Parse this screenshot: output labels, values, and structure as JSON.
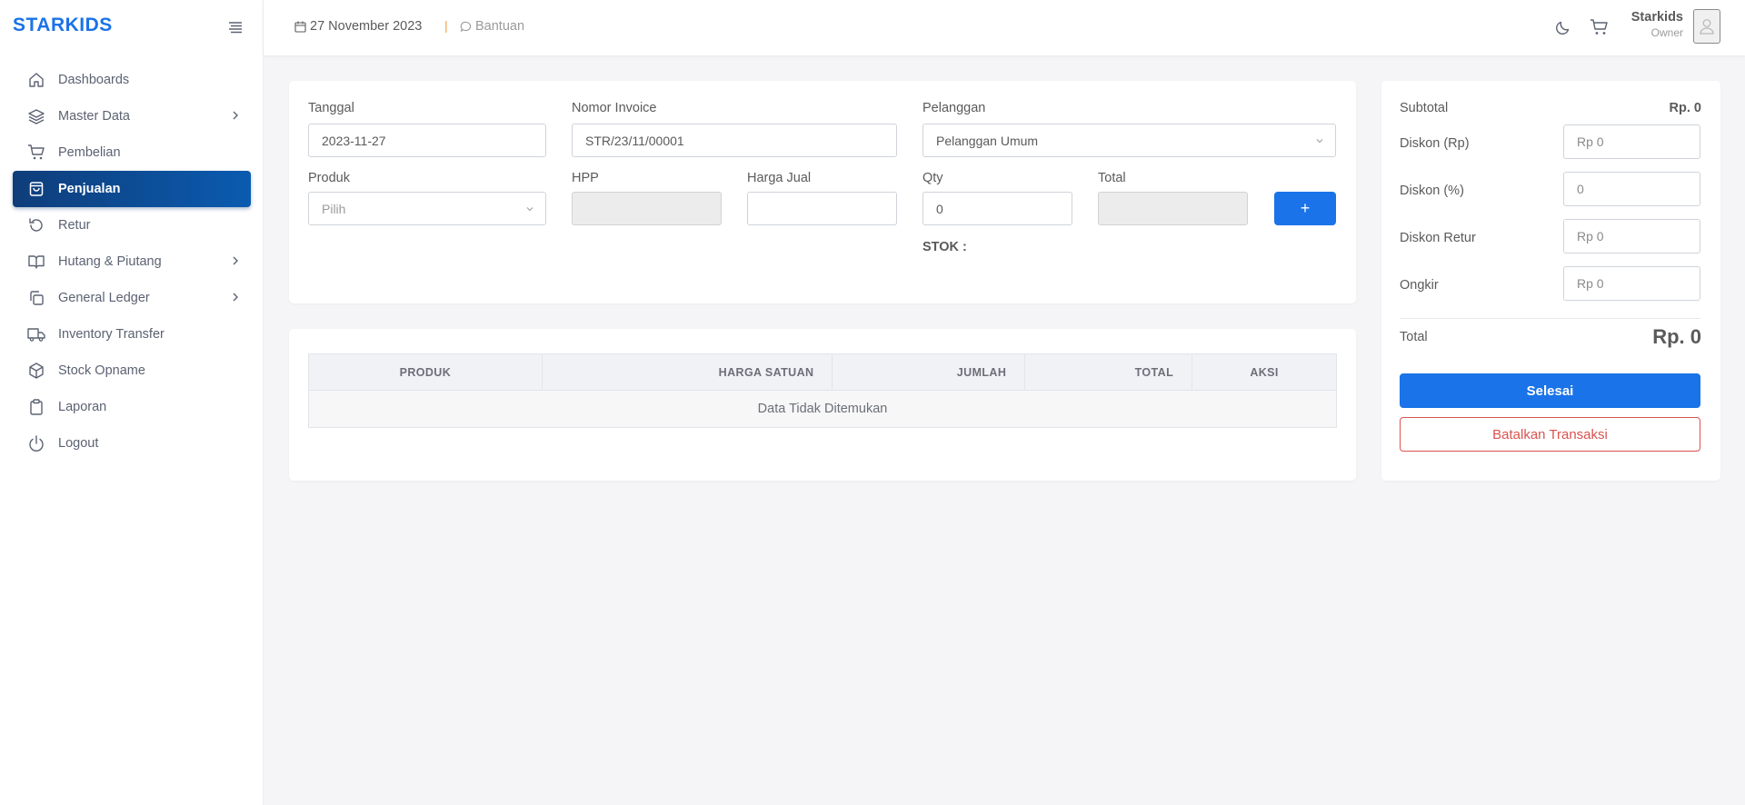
{
  "brand": "STARKIDS",
  "sidebar": {
    "items": [
      {
        "label": "Dashboards",
        "icon": "home-icon"
      },
      {
        "label": "Master Data",
        "icon": "layers-icon",
        "has_submenu": true
      },
      {
        "label": "Pembelian",
        "icon": "cart-icon"
      },
      {
        "label": "Penjualan",
        "icon": "shopping-bag-icon",
        "active": true
      },
      {
        "label": "Retur",
        "icon": "refresh-icon"
      },
      {
        "label": "Hutang & Piutang",
        "icon": "book-icon",
        "has_submenu": true
      },
      {
        "label": "General Ledger",
        "icon": "copy-icon",
        "has_submenu": true
      },
      {
        "label": "Inventory Transfer",
        "icon": "truck-icon"
      },
      {
        "label": "Stock Opname",
        "icon": "box-icon"
      },
      {
        "label": "Laporan",
        "icon": "clipboard-icon"
      },
      {
        "label": "Logout",
        "icon": "power-icon"
      }
    ]
  },
  "header": {
    "date": "27 November 2023",
    "separator": "|",
    "help": "Bantuan",
    "user_name": "Starkids",
    "user_role": "Owner"
  },
  "form": {
    "tanggal": {
      "label": "Tanggal",
      "value": "2023-11-27"
    },
    "invoice": {
      "label": "Nomor Invoice",
      "value": "STR/23/11/00001"
    },
    "pelanggan": {
      "label": "Pelanggan",
      "value": "Pelanggan Umum"
    },
    "produk": {
      "label": "Produk",
      "placeholder": "Pilih"
    },
    "hpp": {
      "label": "HPP",
      "value": ""
    },
    "harga_jual": {
      "label": "Harga Jual",
      "value": ""
    },
    "qty": {
      "label": "Qty",
      "value": "0"
    },
    "total": {
      "label": "Total",
      "value": ""
    },
    "add_label": "+",
    "stok_label": "STOK :"
  },
  "table": {
    "columns": [
      "PRODUK",
      "HARGA SATUAN",
      "JUMLAH",
      "TOTAL",
      "AKSI"
    ],
    "empty_message": "Data Tidak Ditemukan"
  },
  "summary": {
    "subtotal_label": "Subtotal",
    "subtotal_value": "Rp. 0",
    "diskon_rp_label": "Diskon (Rp)",
    "diskon_rp_value": "Rp 0",
    "diskon_pct_label": "Diskon (%)",
    "diskon_pct_value": "0",
    "diskon_retur_label": "Diskon Retur",
    "diskon_retur_value": "Rp 0",
    "ongkir_label": "Ongkir",
    "ongkir_value": "Rp 0",
    "total_label": "Total",
    "total_value": "Rp. 0",
    "done_label": "Selesai",
    "cancel_label": "Batalkan Transaksi"
  },
  "colors": {
    "accent": "#1a73e8",
    "active_nav": "#0a5bb0",
    "danger": "#d9534f",
    "separator": "#f4a340"
  }
}
